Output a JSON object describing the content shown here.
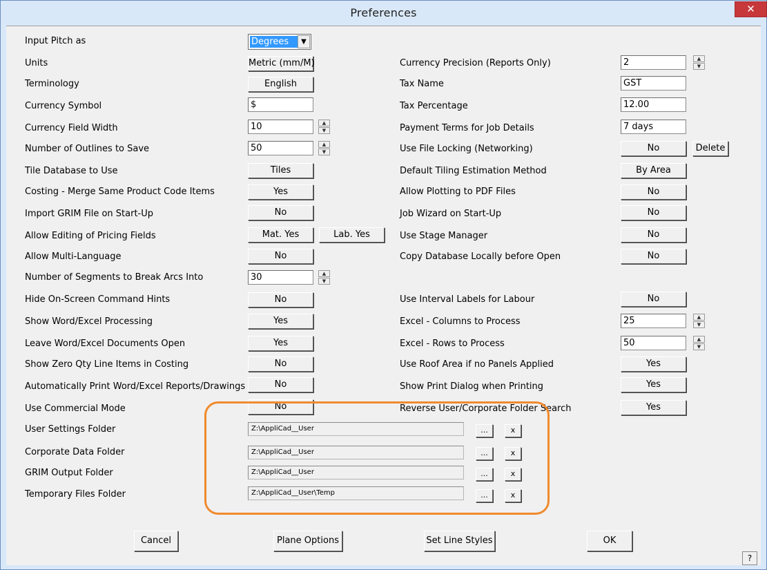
{
  "window": {
    "title": "Preferences",
    "close_glyph": "✕"
  },
  "input_pitch": {
    "label": "Input Pitch as",
    "value": "Degrees",
    "arrow": "▼"
  },
  "left_rows": [
    {
      "label": "Units",
      "value": "Metric (mm/M)"
    },
    {
      "label": "Terminology",
      "value": "English"
    },
    {
      "label": "Currency Symbol",
      "value": "$"
    },
    {
      "label": "Currency Field Width",
      "value": "10"
    },
    {
      "label": "Number of Outlines to Save",
      "value": "50"
    },
    {
      "label": "Tile Database to Use",
      "value": "Tiles"
    },
    {
      "label": "Costing - Merge Same Product Code Items",
      "value": "Yes"
    },
    {
      "label": "Import GRIM File on Start-Up",
      "value": "No"
    },
    {
      "label": "Allow Editing of Pricing Fields",
      "value": "Mat. Yes",
      "value2": "Lab. Yes"
    },
    {
      "label": "Allow Multi-Language",
      "value": "No"
    },
    {
      "label": "Number of Segments to Break Arcs Into",
      "value": "30"
    },
    {
      "label": "Hide On-Screen Command Hints",
      "value": "No"
    },
    {
      "label": "Show Word/Excel Processing",
      "value": "Yes"
    },
    {
      "label": "Leave Word/Excel Documents Open",
      "value": "Yes"
    },
    {
      "label": "Show Zero Qty Line Items in Costing",
      "value": "No"
    },
    {
      "label": "Automatically Print Word/Excel Reports/Drawings",
      "value": "No"
    },
    {
      "label": "Use Commercial Mode",
      "value": "No"
    }
  ],
  "right_rows": [
    {
      "label": "Currency Precision (Reports Only)",
      "value": "2"
    },
    {
      "label": "Tax Name",
      "value": "GST"
    },
    {
      "label": "Tax Percentage",
      "value": "12.00"
    },
    {
      "label": "Payment Terms for Job Details",
      "value": "7 days"
    },
    {
      "label": "Use File Locking (Networking)",
      "value": "No",
      "extra": "Delete"
    },
    {
      "label": "Default Tiling Estimation Method",
      "value": "By Area"
    },
    {
      "label": "Allow Plotting to PDF Files",
      "value": "No"
    },
    {
      "label": "Job Wizard on Start-Up",
      "value": "No"
    },
    {
      "label": "Use Stage Manager",
      "value": "No"
    },
    {
      "label": "Copy Database Locally before Open",
      "value": "No"
    },
    {
      "label": "Use Interval Labels for Labour",
      "value": "No"
    },
    {
      "label": "Excel - Columns to Process",
      "value": "25"
    },
    {
      "label": "Excel - Rows to Process",
      "value": "50"
    },
    {
      "label": "Use Roof Area if no Panels Applied",
      "value": "Yes"
    },
    {
      "label": "Show Print Dialog when Printing",
      "value": "Yes"
    },
    {
      "label": "Reverse User/Corporate Folder Search",
      "value": "Yes"
    }
  ],
  "folders": [
    {
      "label": "User Settings Folder",
      "value": "Z:\\AppliCad__User"
    },
    {
      "label": "Corporate Data Folder",
      "value": "Z:\\AppliCad__User"
    },
    {
      "label": "GRIM Output Folder",
      "value": "Z:\\AppliCad__User"
    },
    {
      "label": "Temporary Files Folder",
      "value": "Z:\\AppliCad__User\\Temp"
    }
  ],
  "folder_buttons": {
    "browse": "...",
    "clear": "x"
  },
  "spinner": {
    "up": "▲",
    "down": "▼"
  },
  "footer": {
    "cancel": "Cancel",
    "plane_options": "Plane Options",
    "set_line_styles": "Set Line Styles",
    "ok": "OK",
    "help": "?"
  },
  "colors": {
    "highlight": "#f08a2c",
    "selection": "#3399ff",
    "close": "#c7383b"
  }
}
